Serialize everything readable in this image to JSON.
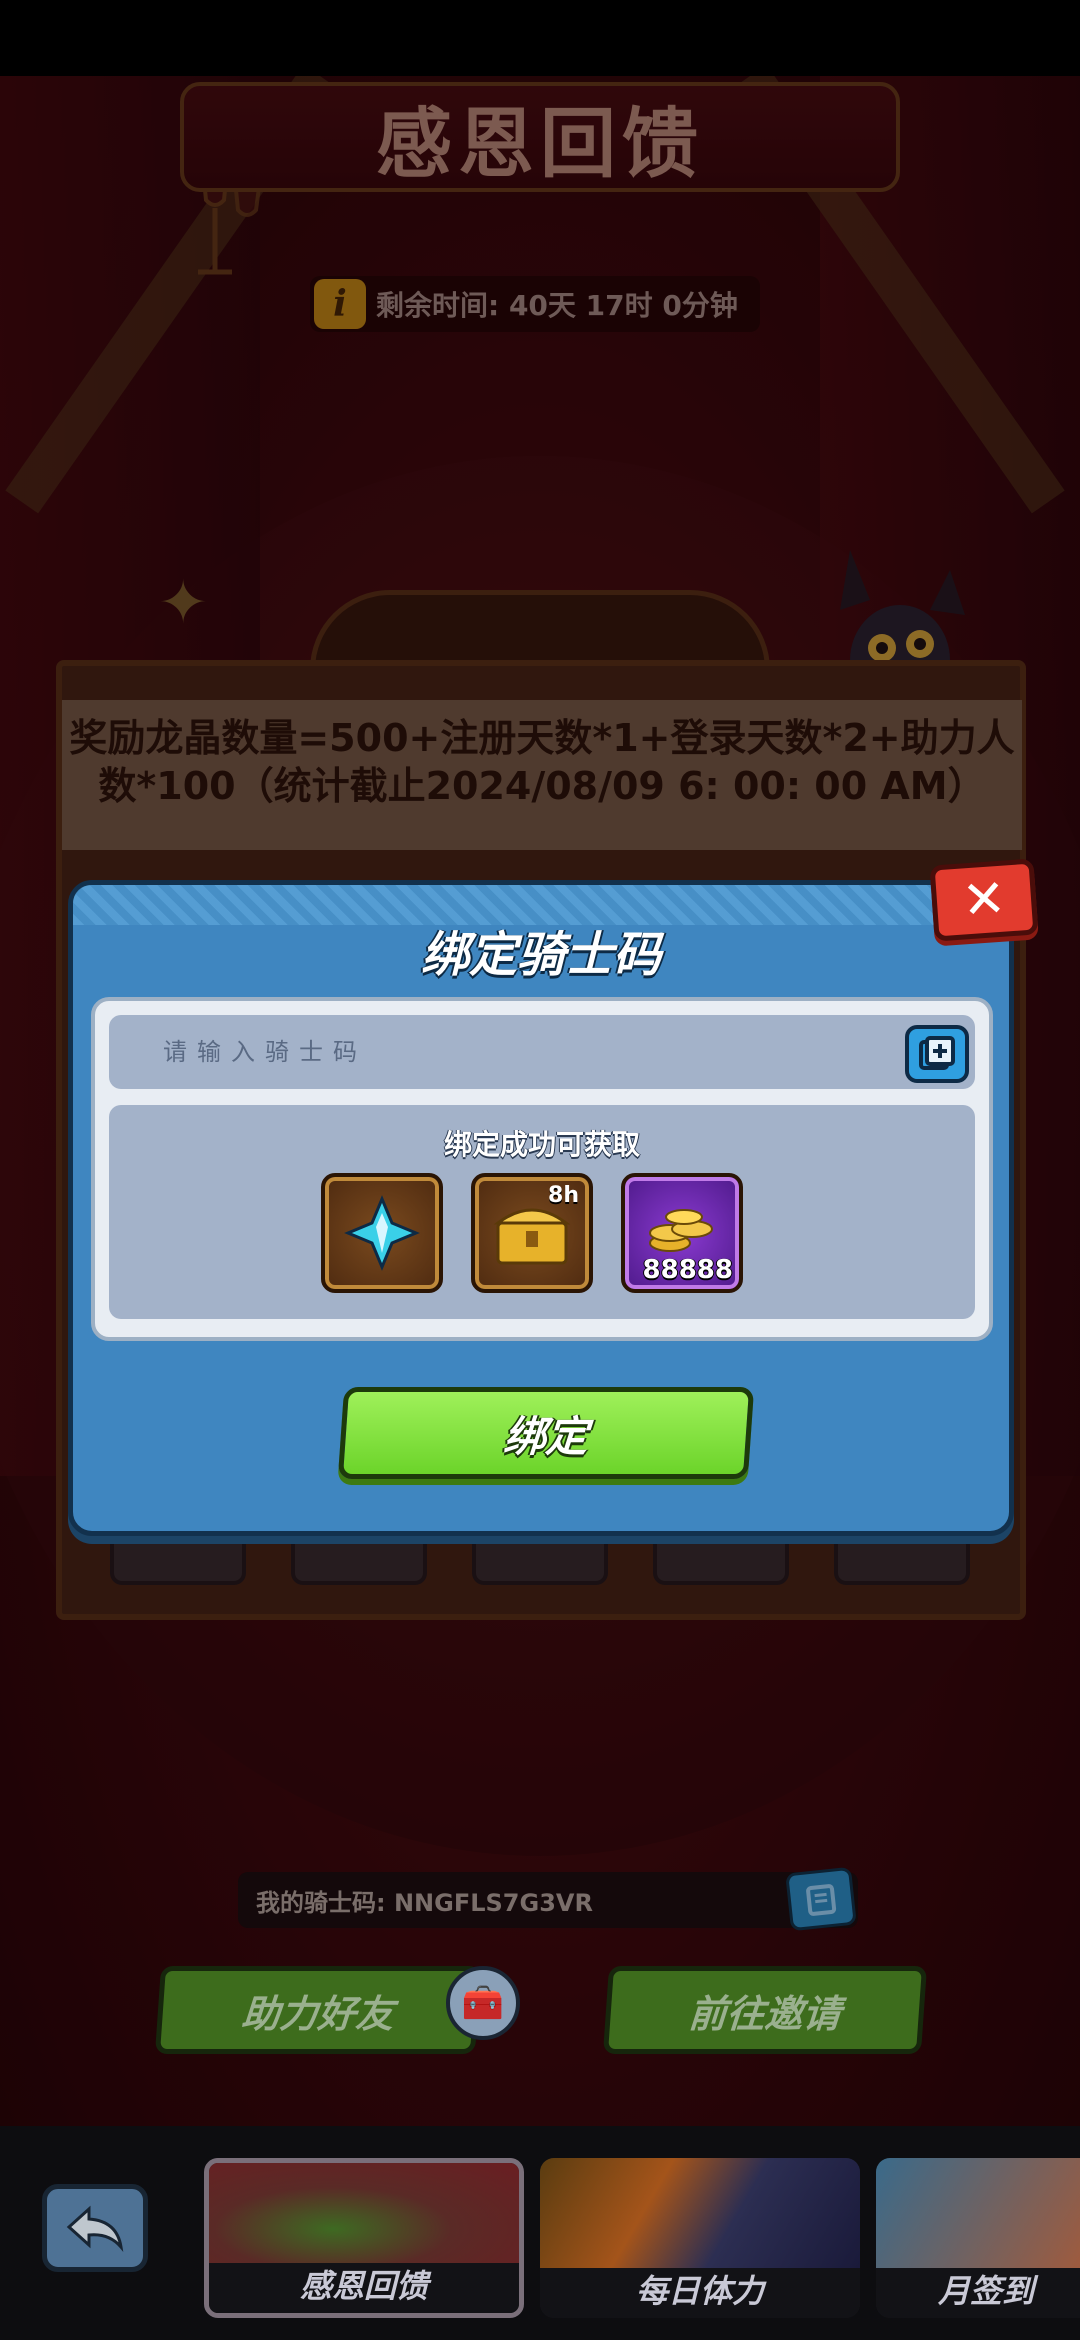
{
  "header": {
    "title": "感恩回馈",
    "remaining_time": "剩余时间: 40天 17时 0分钟",
    "info_icon_glyph": "i"
  },
  "board": {
    "formula_text": "奖励龙晶数量=500+注册天数*1+登录天数*2+助力人数*100（统计截止2024/08/09 6: 00: 00 AM）"
  },
  "dialog": {
    "title": "绑定骑士码",
    "close_glyph": "✕",
    "input_placeholder": "请输入骑士码",
    "reward_heading": "绑定成功可获取",
    "rewards": [
      {
        "icon": "crystal-shard-icon",
        "qty": ""
      },
      {
        "icon": "treasure-chest-icon",
        "duration": "8h"
      },
      {
        "icon": "gold-coins-icon",
        "qty": "88888"
      }
    ],
    "bind_label": "绑定"
  },
  "my_code": {
    "text": "我的骑士码: NNGFLS7G3VR"
  },
  "actions": {
    "help_friend": "助力好友",
    "go_invite": "前往邀请"
  },
  "bottom_nav": {
    "tabs": [
      {
        "label": "感恩回馈",
        "active": true
      },
      {
        "label": "每日体力",
        "active": false
      },
      {
        "label": "月签到",
        "active": false
      }
    ]
  },
  "colors": {
    "dialog_bg": "#3f86c0",
    "bind_button": "#7bdc36",
    "close_button": "#e23b2e",
    "stage_bg": "#2d080b"
  }
}
